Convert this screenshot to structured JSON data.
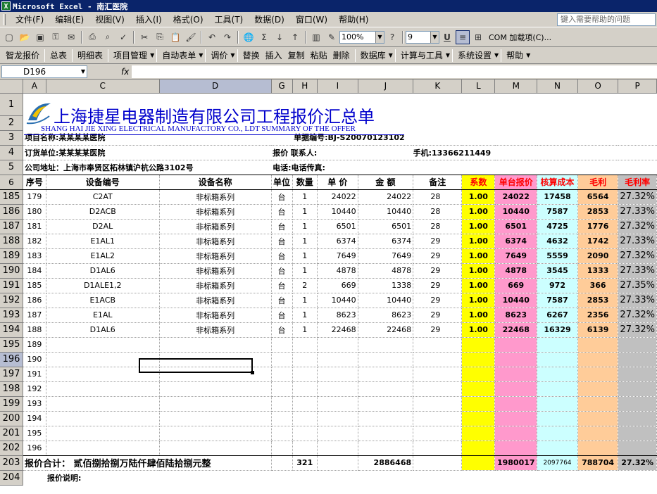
{
  "window": {
    "title": "Microsoft Excel - 南汇医院",
    "icon": "excel-icon"
  },
  "menu": {
    "items": [
      "文件(F)",
      "编辑(E)",
      "视图(V)",
      "插入(I)",
      "格式(O)",
      "工具(T)",
      "数据(D)",
      "窗口(W)",
      "帮助(H)"
    ],
    "help_placeholder": "键入需要帮助的问题"
  },
  "toolbar": {
    "zoom": "100%",
    "font_size": "9",
    "addins": "COM 加载项(C)..."
  },
  "toolbar2": {
    "items": [
      "智龙报价",
      "总表",
      "明细表",
      "项目管理",
      "自动表单",
      "调价",
      "替换",
      "插入",
      "复制",
      "粘贴",
      "删除",
      "数据库",
      "计算与工具",
      "系统设置",
      "帮助"
    ]
  },
  "formula_bar": {
    "cell_ref": "D196",
    "fx": "fx",
    "content": ""
  },
  "columns": [
    "A",
    "C",
    "D",
    "G",
    "H",
    "I",
    "J",
    "K",
    "L",
    "M",
    "N",
    "O",
    "P"
  ],
  "doc": {
    "title": "上海捷星电器制造有限公司工程报价汇总单",
    "subtitle": "SHANG HAI JIE XING ELECTRICAL MANUFACTORY CO., LDT SUMMARY OF THE OFFER",
    "project": "项目名称:某某某某医院",
    "order_no": "单据编号:BJ-S20070123102",
    "client": "订货单位:某某某某医院",
    "contact": "报价 联系人:",
    "phone": "手机:13366211449",
    "address": "公司地址：上海市奉贤区柘林镇沪杭公路3102号",
    "tel": "电话:电话传真:"
  },
  "headers": {
    "seq": "序号",
    "code": "设备编号",
    "name": "设备名称",
    "unit": "单位",
    "qty": "数量",
    "price": "单 价",
    "amount": "金 额",
    "note": "备注",
    "coef": "系数",
    "unit_quote": "单台报价",
    "cost": "核算成本",
    "profit": "毛利",
    "margin": "毛利率"
  },
  "rows": [
    {
      "row": "185",
      "seq": "179",
      "code": "C2AT",
      "name": "非标箱系列",
      "unit": "台",
      "qty": "1",
      "price": "24022",
      "amount": "24022",
      "note": "28",
      "coef": "1.00",
      "quote": "24022",
      "cost": "17458",
      "profit": "6564",
      "margin": "27.32%"
    },
    {
      "row": "186",
      "seq": "180",
      "code": "D2ACB",
      "name": "非标箱系列",
      "unit": "台",
      "qty": "1",
      "price": "10440",
      "amount": "10440",
      "note": "28",
      "coef": "1.00",
      "quote": "10440",
      "cost": "7587",
      "profit": "2853",
      "margin": "27.33%"
    },
    {
      "row": "187",
      "seq": "181",
      "code": "D2AL",
      "name": "非标箱系列",
      "unit": "台",
      "qty": "1",
      "price": "6501",
      "amount": "6501",
      "note": "28",
      "coef": "1.00",
      "quote": "6501",
      "cost": "4725",
      "profit": "1776",
      "margin": "27.32%"
    },
    {
      "row": "188",
      "seq": "182",
      "code": "E1AL1",
      "name": "非标箱系列",
      "unit": "台",
      "qty": "1",
      "price": "6374",
      "amount": "6374",
      "note": "29",
      "coef": "1.00",
      "quote": "6374",
      "cost": "4632",
      "profit": "1742",
      "margin": "27.33%"
    },
    {
      "row": "189",
      "seq": "183",
      "code": "E1AL2",
      "name": "非标箱系列",
      "unit": "台",
      "qty": "1",
      "price": "7649",
      "amount": "7649",
      "note": "29",
      "coef": "1.00",
      "quote": "7649",
      "cost": "5559",
      "profit": "2090",
      "margin": "27.32%"
    },
    {
      "row": "190",
      "seq": "184",
      "code": "D1AL6",
      "name": "非标箱系列",
      "unit": "台",
      "qty": "1",
      "price": "4878",
      "amount": "4878",
      "note": "29",
      "coef": "1.00",
      "quote": "4878",
      "cost": "3545",
      "profit": "1333",
      "margin": "27.33%"
    },
    {
      "row": "191",
      "seq": "185",
      "code": "D1ALE1,2",
      "name": "非标箱系列",
      "unit": "台",
      "qty": "2",
      "price": "669",
      "amount": "1338",
      "note": "29",
      "coef": "1.00",
      "quote": "669",
      "cost": "972",
      "profit": "366",
      "margin": "27.35%"
    },
    {
      "row": "192",
      "seq": "186",
      "code": "E1ACB",
      "name": "非标箱系列",
      "unit": "台",
      "qty": "1",
      "price": "10440",
      "amount": "10440",
      "note": "29",
      "coef": "1.00",
      "quote": "10440",
      "cost": "7587",
      "profit": "2853",
      "margin": "27.33%"
    },
    {
      "row": "193",
      "seq": "187",
      "code": "E1AL",
      "name": "非标箱系列",
      "unit": "台",
      "qty": "1",
      "price": "8623",
      "amount": "8623",
      "note": "29",
      "coef": "1.00",
      "quote": "8623",
      "cost": "6267",
      "profit": "2356",
      "margin": "27.32%"
    },
    {
      "row": "194",
      "seq": "188",
      "code": "D1AL6",
      "name": "非标箱系列",
      "unit": "台",
      "qty": "1",
      "price": "22468",
      "amount": "22468",
      "note": "29",
      "coef": "1.00",
      "quote": "22468",
      "cost": "16329",
      "profit": "6139",
      "margin": "27.32%"
    }
  ],
  "empty_rows": [
    {
      "row": "195",
      "seq": "189"
    },
    {
      "row": "196",
      "seq": "190"
    },
    {
      "row": "197",
      "seq": "191"
    },
    {
      "row": "198",
      "seq": "192"
    },
    {
      "row": "199",
      "seq": "193"
    },
    {
      "row": "200",
      "seq": "194"
    },
    {
      "row": "201",
      "seq": "195"
    },
    {
      "row": "202",
      "seq": "196"
    }
  ],
  "total": {
    "row": "203",
    "label": "报价合计：  贰佰捌拾捌万陆仟肆佰陆拾捌元整",
    "qty": "321",
    "amount": "2886468",
    "quote": "1980017",
    "cost": "2097764",
    "profit": "788704",
    "margin": "27.32%"
  },
  "note_row": {
    "row": "204",
    "label": "报价说明:"
  },
  "colors": {
    "coef": "#ffff00",
    "quote": "#ff99cc",
    "cost": "#ccffff",
    "profit": "#ffcc99",
    "margin": "#c0c0c0",
    "title": "#0000cc"
  }
}
